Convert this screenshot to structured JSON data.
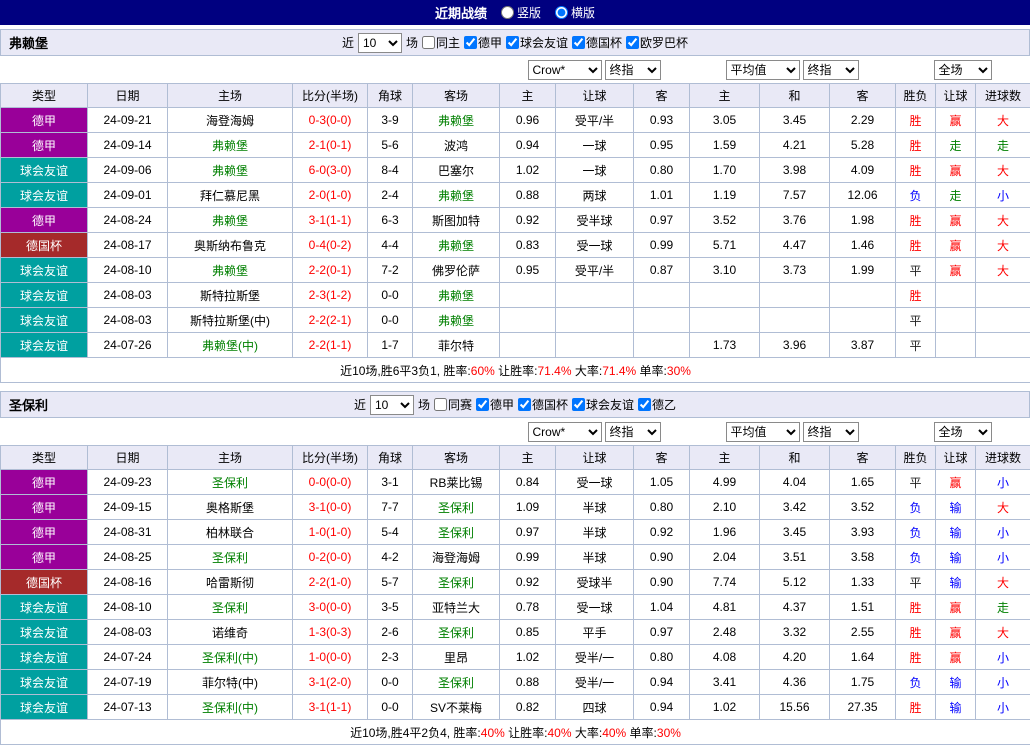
{
  "colors": {
    "title_bar_bg": "#000080",
    "title_text": "#ffffff",
    "header_bg": "#e9e9f6",
    "grid_border": "#b0bdd4",
    "win_red": "#ff0000",
    "loss_blue": "#0000ff",
    "push_green": "#008000",
    "draw_dark": "#222222",
    "team_highlight_green": "#008000",
    "score_red": "#ff0000"
  },
  "league_colors": {
    "德甲": "#990099",
    "球会友谊": "#00a0a0",
    "德国杯": "#a52a2a"
  },
  "title_bar": {
    "title": "近期战绩",
    "layout_options": [
      {
        "label": "竖版",
        "checked": false
      },
      {
        "label": "横版",
        "checked": true
      }
    ]
  },
  "sections": [
    {
      "team": "弗赖堡",
      "filter": {
        "prefix": "近",
        "count": "10",
        "suffix": "场",
        "same": {
          "label": "同主",
          "checked": false
        },
        "leagues": [
          {
            "label": "德甲",
            "checked": true
          },
          {
            "label": "球会友谊",
            "checked": true
          },
          {
            "label": "德国杯",
            "checked": true
          },
          {
            "label": "欧罗巴杯",
            "checked": true
          }
        ]
      },
      "selects": {
        "asia_source": "Crow*",
        "asia_time": "终指",
        "euro_source": "平均值",
        "euro_time": "终指",
        "scope": "全场"
      },
      "columns": [
        "类型",
        "日期",
        "主场",
        "比分(半场)",
        "角球",
        "客场",
        "主",
        "让球",
        "客",
        "主",
        "和",
        "客",
        "胜负",
        "让球",
        "进球数"
      ],
      "rows": [
        {
          "league": "德甲",
          "date": "24-09-21",
          "home": "海登海姆",
          "home_team": false,
          "score": "0-3(0-0)",
          "corner": "3-9",
          "away": "弗赖堡",
          "away_team": true,
          "asia": [
            "0.96",
            "受平/半",
            "0.93"
          ],
          "euro": [
            "3.05",
            "3.45",
            "2.29"
          ],
          "result": "胜",
          "handicap_result": "赢",
          "goals": "大"
        },
        {
          "league": "德甲",
          "date": "24-09-14",
          "home": "弗赖堡",
          "home_team": true,
          "score": "2-1(0-1)",
          "corner": "5-6",
          "away": "波鸿",
          "away_team": false,
          "asia": [
            "0.94",
            "一球",
            "0.95"
          ],
          "euro": [
            "1.59",
            "4.21",
            "5.28"
          ],
          "result": "胜",
          "handicap_result": "走",
          "goals": "走"
        },
        {
          "league": "球会友谊",
          "date": "24-09-06",
          "home": "弗赖堡",
          "home_team": true,
          "score": "6-0(3-0)",
          "corner": "8-4",
          "away": "巴塞尔",
          "away_team": false,
          "asia": [
            "1.02",
            "一球",
            "0.80"
          ],
          "euro": [
            "1.70",
            "3.98",
            "4.09"
          ],
          "result": "胜",
          "handicap_result": "赢",
          "goals": "大"
        },
        {
          "league": "球会友谊",
          "date": "24-09-01",
          "home": "拜仁慕尼黑",
          "home_team": false,
          "score": "2-0(1-0)",
          "corner": "2-4",
          "away": "弗赖堡",
          "away_team": true,
          "asia": [
            "0.88",
            "两球",
            "1.01"
          ],
          "euro": [
            "1.19",
            "7.57",
            "12.06"
          ],
          "result": "负",
          "handicap_result": "走",
          "goals": "小"
        },
        {
          "league": "德甲",
          "date": "24-08-24",
          "home": "弗赖堡",
          "home_team": true,
          "score": "3-1(1-1)",
          "corner": "6-3",
          "away": "斯图加特",
          "away_team": false,
          "asia": [
            "0.92",
            "受半球",
            "0.97"
          ],
          "euro": [
            "3.52",
            "3.76",
            "1.98"
          ],
          "result": "胜",
          "handicap_result": "赢",
          "goals": "大"
        },
        {
          "league": "德国杯",
          "date": "24-08-17",
          "home": "奥斯纳布鲁克",
          "home_team": false,
          "score": "0-4(0-2)",
          "corner": "4-4",
          "away": "弗赖堡",
          "away_team": true,
          "asia": [
            "0.83",
            "受一球",
            "0.99"
          ],
          "euro": [
            "5.71",
            "4.47",
            "1.46"
          ],
          "result": "胜",
          "handicap_result": "赢",
          "goals": "大"
        },
        {
          "league": "球会友谊",
          "date": "24-08-10",
          "home": "弗赖堡",
          "home_team": true,
          "score": "2-2(0-1)",
          "corner": "7-2",
          "away": "佛罗伦萨",
          "away_team": false,
          "asia": [
            "0.95",
            "受平/半",
            "0.87"
          ],
          "euro": [
            "3.10",
            "3.73",
            "1.99"
          ],
          "result": "平",
          "handicap_result": "赢",
          "goals": "大"
        },
        {
          "league": "球会友谊",
          "date": "24-08-03",
          "home": "斯特拉斯堡",
          "home_team": false,
          "score": "2-3(1-2)",
          "corner": "0-0",
          "away": "弗赖堡",
          "away_team": true,
          "asia": [
            "",
            "",
            ""
          ],
          "euro": [
            "",
            "",
            ""
          ],
          "result": "胜",
          "handicap_result": "",
          "goals": ""
        },
        {
          "league": "球会友谊",
          "date": "24-08-03",
          "home": "斯特拉斯堡(中)",
          "home_team": false,
          "score": "2-2(2-1)",
          "corner": "0-0",
          "away": "弗赖堡",
          "away_team": true,
          "asia": [
            "",
            "",
            ""
          ],
          "euro": [
            "",
            "",
            ""
          ],
          "result": "平",
          "handicap_result": "",
          "goals": ""
        },
        {
          "league": "球会友谊",
          "date": "24-07-26",
          "home": "弗赖堡(中)",
          "home_team": true,
          "score": "2-2(1-1)",
          "corner": "1-7",
          "away": "菲尔特",
          "away_team": false,
          "asia": [
            "",
            "",
            ""
          ],
          "euro": [
            "1.73",
            "3.96",
            "3.87"
          ],
          "result": "平",
          "handicap_result": "",
          "goals": ""
        }
      ],
      "summary": [
        {
          "text": "近10场,胜6平3负1, 胜率:",
          "red": false
        },
        {
          "text": "60%",
          "red": true
        },
        {
          "text": " 让胜率:",
          "red": false
        },
        {
          "text": "71.4%",
          "red": true
        },
        {
          "text": " 大率:",
          "red": false
        },
        {
          "text": "71.4%",
          "red": true
        },
        {
          "text": " 单率:",
          "red": false
        },
        {
          "text": "30%",
          "red": true
        }
      ]
    },
    {
      "team": "圣保利",
      "filter": {
        "prefix": "近",
        "count": "10",
        "suffix": "场",
        "same": {
          "label": "同赛",
          "checked": false
        },
        "leagues": [
          {
            "label": "德甲",
            "checked": true
          },
          {
            "label": "德国杯",
            "checked": true
          },
          {
            "label": "球会友谊",
            "checked": true
          },
          {
            "label": "德乙",
            "checked": true
          }
        ]
      },
      "selects": {
        "asia_source": "Crow*",
        "asia_time": "终指",
        "euro_source": "平均值",
        "euro_time": "终指",
        "scope": "全场"
      },
      "columns": [
        "类型",
        "日期",
        "主场",
        "比分(半场)",
        "角球",
        "客场",
        "主",
        "让球",
        "客",
        "主",
        "和",
        "客",
        "胜负",
        "让球",
        "进球数"
      ],
      "rows": [
        {
          "league": "德甲",
          "date": "24-09-23",
          "home": "圣保利",
          "home_team": true,
          "score": "0-0(0-0)",
          "corner": "3-1",
          "away": "RB莱比锡",
          "away_team": false,
          "asia": [
            "0.84",
            "受一球",
            "1.05"
          ],
          "euro": [
            "4.99",
            "4.04",
            "1.65"
          ],
          "result": "平",
          "handicap_result": "赢",
          "goals": "小"
        },
        {
          "league": "德甲",
          "date": "24-09-15",
          "home": "奥格斯堡",
          "home_team": false,
          "score": "3-1(0-0)",
          "corner": "7-7",
          "away": "圣保利",
          "away_team": true,
          "asia": [
            "1.09",
            "半球",
            "0.80"
          ],
          "euro": [
            "2.10",
            "3.42",
            "3.52"
          ],
          "result": "负",
          "handicap_result": "输",
          "goals": "大"
        },
        {
          "league": "德甲",
          "date": "24-08-31",
          "home": "柏林联合",
          "home_team": false,
          "score": "1-0(1-0)",
          "corner": "5-4",
          "away": "圣保利",
          "away_team": true,
          "asia": [
            "0.97",
            "半球",
            "0.92"
          ],
          "euro": [
            "1.96",
            "3.45",
            "3.93"
          ],
          "result": "负",
          "handicap_result": "输",
          "goals": "小"
        },
        {
          "league": "德甲",
          "date": "24-08-25",
          "home": "圣保利",
          "home_team": true,
          "score": "0-2(0-0)",
          "corner": "4-2",
          "away": "海登海姆",
          "away_team": false,
          "asia": [
            "0.99",
            "半球",
            "0.90"
          ],
          "euro": [
            "2.04",
            "3.51",
            "3.58"
          ],
          "result": "负",
          "handicap_result": "输",
          "goals": "小"
        },
        {
          "league": "德国杯",
          "date": "24-08-16",
          "home": "哈雷斯彻",
          "home_team": false,
          "score": "2-2(1-0)",
          "corner": "5-7",
          "away": "圣保利",
          "away_team": true,
          "asia": [
            "0.92",
            "受球半",
            "0.90"
          ],
          "euro": [
            "7.74",
            "5.12",
            "1.33"
          ],
          "result": "平",
          "handicap_result": "输",
          "goals": "大"
        },
        {
          "league": "球会友谊",
          "date": "24-08-10",
          "home": "圣保利",
          "home_team": true,
          "score": "3-0(0-0)",
          "corner": "3-5",
          "away": "亚特兰大",
          "away_team": false,
          "asia": [
            "0.78",
            "受一球",
            "1.04"
          ],
          "euro": [
            "4.81",
            "4.37",
            "1.51"
          ],
          "result": "胜",
          "handicap_result": "赢",
          "goals": "走"
        },
        {
          "league": "球会友谊",
          "date": "24-08-03",
          "home": "诺维奇",
          "home_team": false,
          "score": "1-3(0-3)",
          "corner": "2-6",
          "away": "圣保利",
          "away_team": true,
          "asia": [
            "0.85",
            "平手",
            "0.97"
          ],
          "euro": [
            "2.48",
            "3.32",
            "2.55"
          ],
          "result": "胜",
          "handicap_result": "赢",
          "goals": "大"
        },
        {
          "league": "球会友谊",
          "date": "24-07-24",
          "home": "圣保利(中)",
          "home_team": true,
          "score": "1-0(0-0)",
          "corner": "2-3",
          "away": "里昂",
          "away_team": false,
          "asia": [
            "1.02",
            "受半/一",
            "0.80"
          ],
          "euro": [
            "4.08",
            "4.20",
            "1.64"
          ],
          "result": "胜",
          "handicap_result": "赢",
          "goals": "小"
        },
        {
          "league": "球会友谊",
          "date": "24-07-19",
          "home": "菲尔特(中)",
          "home_team": false,
          "score": "3-1(2-0)",
          "corner": "0-0",
          "away": "圣保利",
          "away_team": true,
          "asia": [
            "0.88",
            "受半/一",
            "0.94"
          ],
          "euro": [
            "3.41",
            "4.36",
            "1.75"
          ],
          "result": "负",
          "handicap_result": "输",
          "goals": "小"
        },
        {
          "league": "球会友谊",
          "date": "24-07-13",
          "home": "圣保利(中)",
          "home_team": true,
          "score": "3-1(1-1)",
          "corner": "0-0",
          "away": "SV不莱梅",
          "away_team": false,
          "asia": [
            "0.82",
            "四球",
            "0.94"
          ],
          "euro": [
            "1.02",
            "15.56",
            "27.35"
          ],
          "result": "胜",
          "handicap_result": "输",
          "goals": "小"
        }
      ],
      "summary": [
        {
          "text": "近10场,胜4平2负4, 胜率:",
          "red": false
        },
        {
          "text": "40%",
          "red": true
        },
        {
          "text": " 让胜率:",
          "red": false
        },
        {
          "text": "40%",
          "red": true
        },
        {
          "text": " 大率:",
          "red": false
        },
        {
          "text": "40%",
          "red": true
        },
        {
          "text": " 单率:",
          "red": false
        },
        {
          "text": "30%",
          "red": true
        }
      ]
    }
  ]
}
